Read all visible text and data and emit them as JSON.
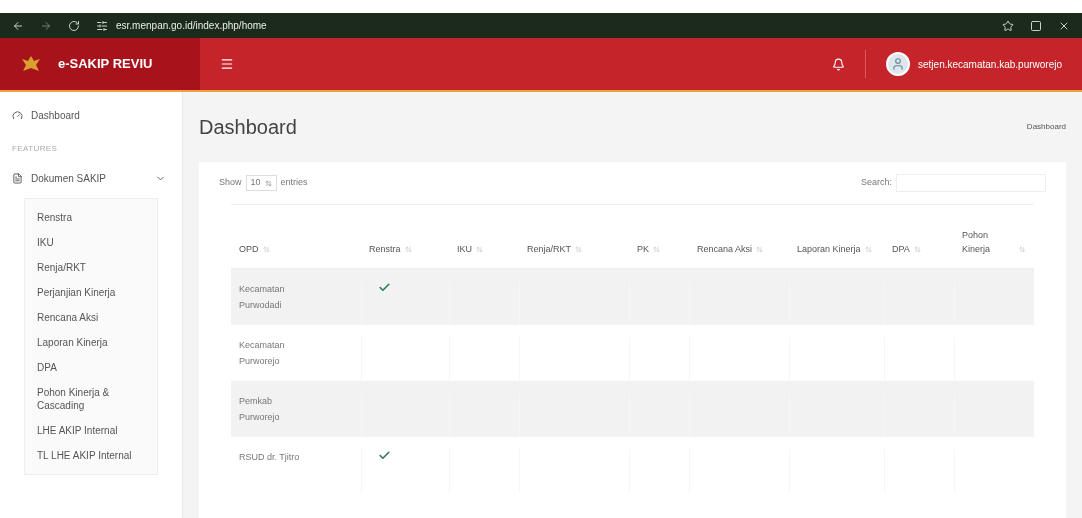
{
  "browser": {
    "url": "esr.menpan.go.id/index.php/home"
  },
  "header": {
    "brand": "e-SAKIP REVIU",
    "user": "setjen.kecamatan.kab.purworejo"
  },
  "sidebar": {
    "top_item": "Dashboard",
    "section": "FEATURES",
    "group": {
      "label": "Dokumen SAKIP",
      "expanded": true,
      "children": [
        {
          "label": "Renstra"
        },
        {
          "label": "IKU"
        },
        {
          "label": "Renja/RKT"
        },
        {
          "label": "Perjanjian Kinerja"
        },
        {
          "label": "Rencana Aksi"
        },
        {
          "label": "Laporan Kinerja"
        },
        {
          "label": "DPA"
        },
        {
          "label": "Pohon Kinerja & Cascading"
        },
        {
          "label": "LHE AKIP Internal"
        },
        {
          "label": "TL LHE AKIP Internal"
        }
      ]
    }
  },
  "page": {
    "title": "Dashboard",
    "breadcrumb": "Dashboard"
  },
  "table_controls": {
    "show_label": "Show",
    "page_size": "10",
    "entries_label": "entries",
    "search_label": "Search:"
  },
  "table": {
    "columns": [
      "OPD",
      "Renstra",
      "IKU",
      "Renja/RKT",
      "PK",
      "Rencana Aksi",
      "Laporan Kinerja",
      "DPA",
      "Pohon Kinerja"
    ],
    "rows": [
      {
        "opd": "Kecamatan Purwodadi",
        "checks": [
          true,
          false,
          false,
          false,
          false,
          false,
          false,
          false
        ]
      },
      {
        "opd": "Kecamatan Purworejo",
        "checks": [
          false,
          false,
          false,
          false,
          false,
          false,
          false,
          false
        ]
      },
      {
        "opd": "Pemkab Purworejo",
        "checks": [
          false,
          false,
          false,
          false,
          false,
          false,
          false,
          false
        ]
      },
      {
        "opd": "RSUD dr. Tjitro",
        "checks": [
          true,
          false,
          false,
          false,
          false,
          false,
          false,
          false
        ]
      }
    ]
  }
}
